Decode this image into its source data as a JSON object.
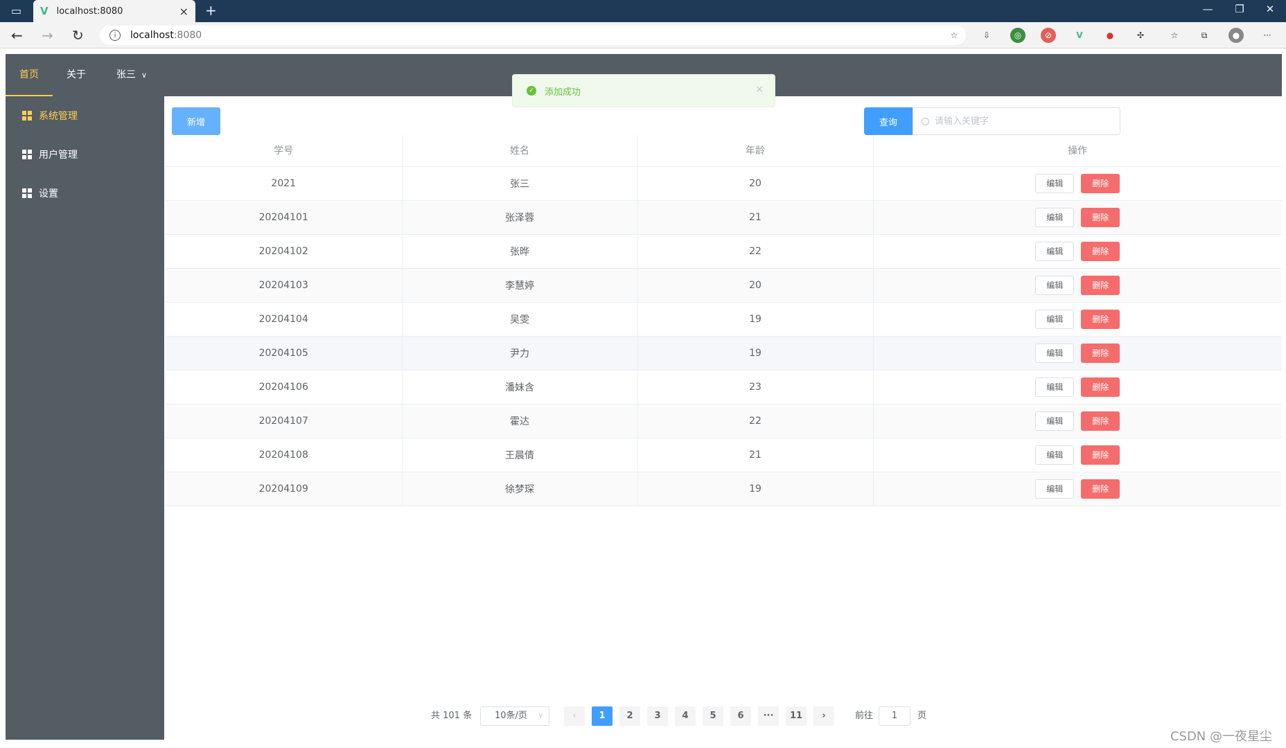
{
  "browser": {
    "tab_title": "localhost:8080",
    "url_host": "localhost",
    "url_port": ":8080"
  },
  "topnav": {
    "items": [
      "首页",
      "关于"
    ],
    "user": "张三"
  },
  "sidebar": {
    "items": [
      "系统管理",
      "用户管理",
      "设置"
    ]
  },
  "toolbar": {
    "add_label": "新增",
    "query_label": "查询",
    "search_placeholder": "请输入关键字"
  },
  "table": {
    "headers": [
      "学号",
      "姓名",
      "年龄",
      "操作"
    ],
    "rows": [
      {
        "id": "2021",
        "name": "张三",
        "age": "20"
      },
      {
        "id": "20204101",
        "name": "张泽蓉",
        "age": "21"
      },
      {
        "id": "20204102",
        "name": "张晔",
        "age": "22"
      },
      {
        "id": "20204103",
        "name": "李慧婷",
        "age": "20"
      },
      {
        "id": "20204104",
        "name": "吴雯",
        "age": "19"
      },
      {
        "id": "20204105",
        "name": "尹力",
        "age": "19"
      },
      {
        "id": "20204106",
        "name": "潘妹含",
        "age": "23"
      },
      {
        "id": "20204107",
        "name": "霍达",
        "age": "22"
      },
      {
        "id": "20204108",
        "name": "王晨倩",
        "age": "21"
      },
      {
        "id": "20204109",
        "name": "徐梦琛",
        "age": "19"
      }
    ],
    "edit_label": "编辑",
    "delete_label": "删除"
  },
  "pagination": {
    "total": "共 101 条",
    "page_size": "10条/页",
    "pages": [
      "1",
      "2",
      "3",
      "4",
      "5",
      "6",
      "···",
      "11"
    ],
    "current": "1",
    "goto_label": "前往",
    "goto_value": "1",
    "page_suffix": "页"
  },
  "toast": {
    "message": "添加成功"
  },
  "watermark": "CSDN @一夜星尘",
  "colors": {
    "primary": "#409eff",
    "danger": "#f56c6c",
    "success": "#67c23a",
    "nav_bg": "#545c64",
    "active_nav": "#ffd04b"
  }
}
